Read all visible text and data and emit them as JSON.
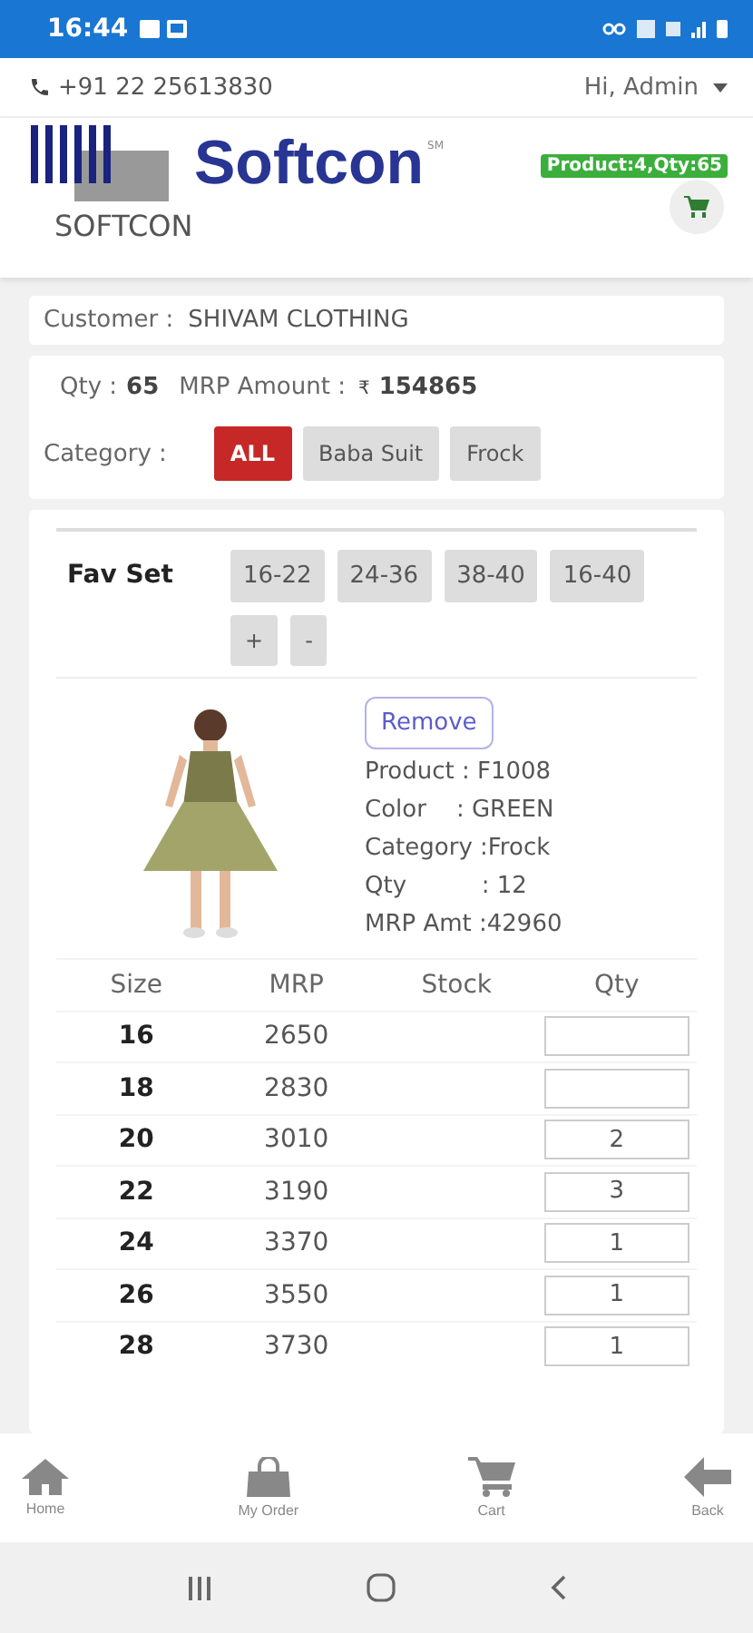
{
  "status_bar": {
    "time": "16:44"
  },
  "top_bar": {
    "phone": "+91 22 25613830",
    "greeting": "Hi, Admin"
  },
  "header": {
    "brand": "Softcon",
    "brand_mark": "SM",
    "caption": "SOFTCON",
    "cart_badge": "Product:4,Qty:65"
  },
  "customer": {
    "label": "Customer :",
    "value": "SHIVAM CLOTHING"
  },
  "summary": {
    "qty_label": "Qty :",
    "qty": "65",
    "amount_label": "MRP Amount :",
    "currency": "₹",
    "amount": "154865"
  },
  "category": {
    "label": "Category :",
    "options": [
      {
        "label": "ALL",
        "selected": true
      },
      {
        "label": "Baba Suit",
        "selected": false
      },
      {
        "label": "Frock",
        "selected": false
      }
    ]
  },
  "fav_set": {
    "label": "Fav Set",
    "sets": [
      "16-22",
      "24-36",
      "38-40",
      "16-40"
    ],
    "buttons": [
      "+",
      "-"
    ]
  },
  "product": {
    "remove": "Remove",
    "details": [
      "Product : F1008",
      "Color    : GREEN",
      "Category :Frock",
      "Qty          : 12",
      "MRP Amt :42960"
    ]
  },
  "table": {
    "columns": [
      "Size",
      "MRP",
      "Stock",
      "Qty"
    ],
    "rows": [
      {
        "size": "16",
        "mrp": "2650"
      },
      {
        "size": "18",
        "mrp": "2830"
      },
      {
        "size": "20",
        "mrp": "3010",
        "qty": "2"
      },
      {
        "size": "22",
        "mrp": "3190",
        "qty": "3"
      },
      {
        "size": "24",
        "mrp": "3370",
        "qty": "1"
      },
      {
        "size": "26",
        "mrp": "3550",
        "qty": "1"
      },
      {
        "size": "28",
        "mrp": "3730",
        "qty": "1"
      }
    ]
  },
  "bottom_nav": [
    {
      "kind": "home",
      "label": "Home"
    },
    {
      "kind": "order",
      "label": "My Order"
    },
    {
      "kind": "cart",
      "label": "Cart"
    },
    {
      "kind": "back",
      "label": "Back"
    }
  ]
}
